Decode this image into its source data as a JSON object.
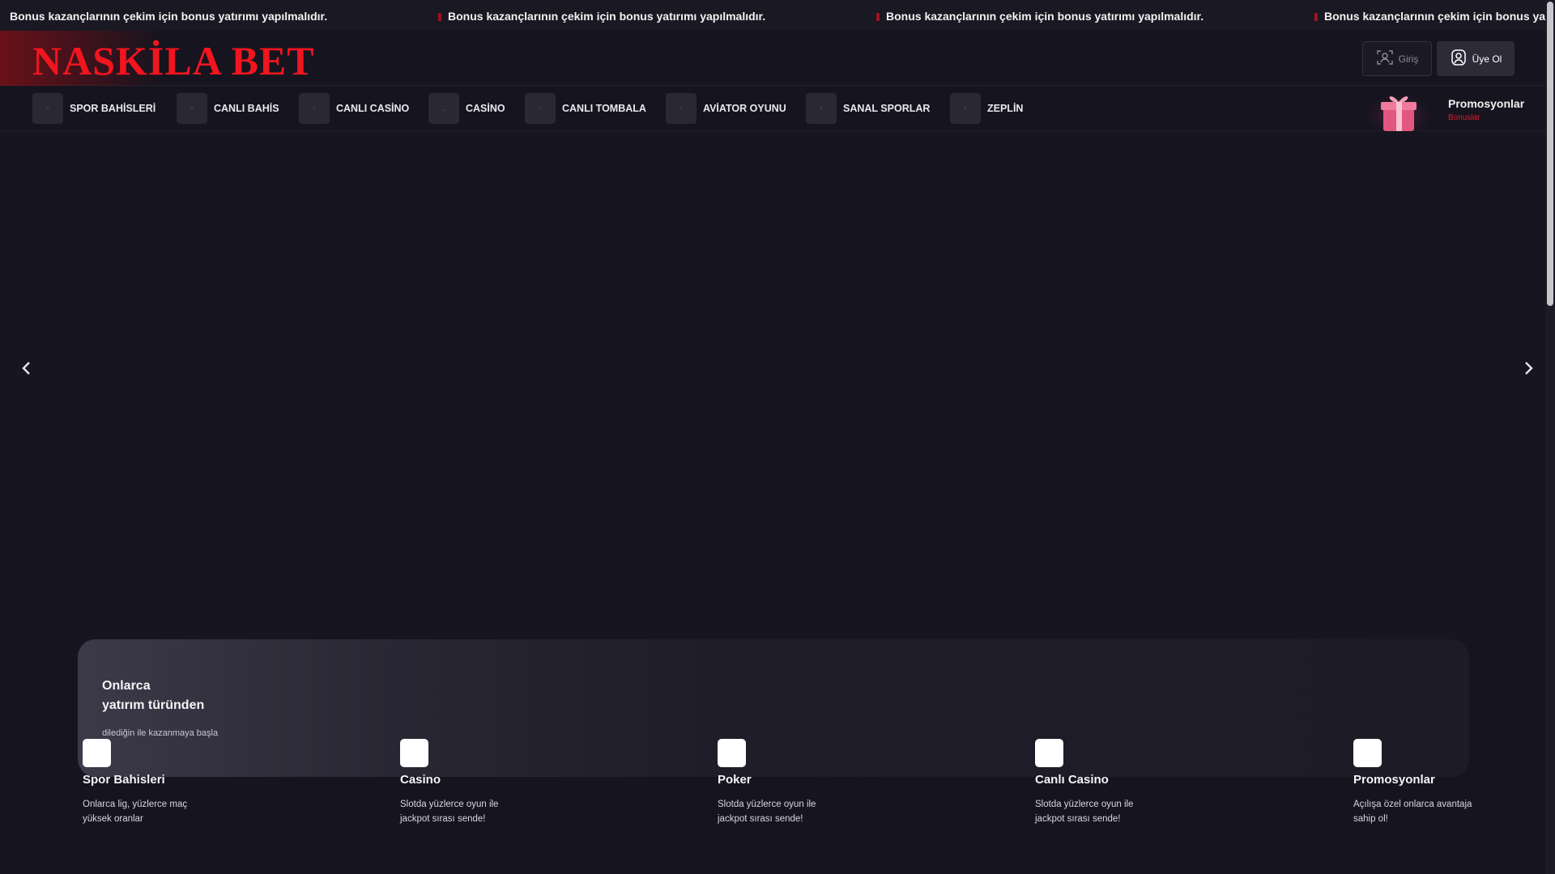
{
  "ticker": {
    "items": [
      "Bonus kazançlarının çekim için bonus yatırımı yapılmalıdır.",
      "Bonus kazançlarının çekim için bonus yatırımı yapılmalıdır.",
      "Bonus kazançlarının çekim için bonus yatırımı yapılmalıdır.",
      "Bonus kazançlarının çekim için bonus yat"
    ]
  },
  "header": {
    "logo": "NASKİLA BET",
    "login_label": "Giriş",
    "register_label": "Üye Ol"
  },
  "nav": {
    "items": [
      {
        "label": "SPOR BAHİSLERİ",
        "icon": "sports-icon"
      },
      {
        "label": "CANLI BAHİS",
        "icon": "live-bet-icon"
      },
      {
        "label": "CANLI CASİNO",
        "icon": "live-casino-icon"
      },
      {
        "label": "CASİNO",
        "icon": "casino-icon"
      },
      {
        "label": "CANLI TOMBALA",
        "icon": "tombala-icon"
      },
      {
        "label": "AVİATOR OYUNU",
        "icon": "aviator-icon"
      },
      {
        "label": "SANAL SPORLAR",
        "icon": "virtual-sports-icon"
      },
      {
        "label": "ZEPLİN",
        "icon": "zeplin-icon"
      }
    ],
    "promo": {
      "title": "Promosyonlar",
      "subtitle": "Bonuslar",
      "icon": "gift-icon"
    }
  },
  "hero": {
    "prev_icon": "chevron-left-icon",
    "next_icon": "chevron-right-icon"
  },
  "features": {
    "panel_title_line1": "Onlarca",
    "panel_title_line2": "yatırım türünden",
    "panel_subtitle": "dilediğin ile kazanmaya başla",
    "items": [
      {
        "title": "Spor Bahisleri",
        "desc": "Onlarca lig, yüzlerce maç yüksek oranlar"
      },
      {
        "title": "Casino",
        "desc": "Slotda yüzlerce oyun ile jackpot sırası sende!"
      },
      {
        "title": "Poker",
        "desc": "Slotda yüzlerce oyun ile jackpot sırası sende!"
      },
      {
        "title": "Canlı Casino",
        "desc": "Slotda yüzlerce oyun ile jackpot sırası sende!"
      },
      {
        "title": "Promosyonlar",
        "desc": "Açılışa özel onlarca avantaja sahip ol!"
      }
    ]
  },
  "colors": {
    "brand": "#f0151e",
    "background": "#16141f",
    "accent_red": "#d4222b"
  }
}
